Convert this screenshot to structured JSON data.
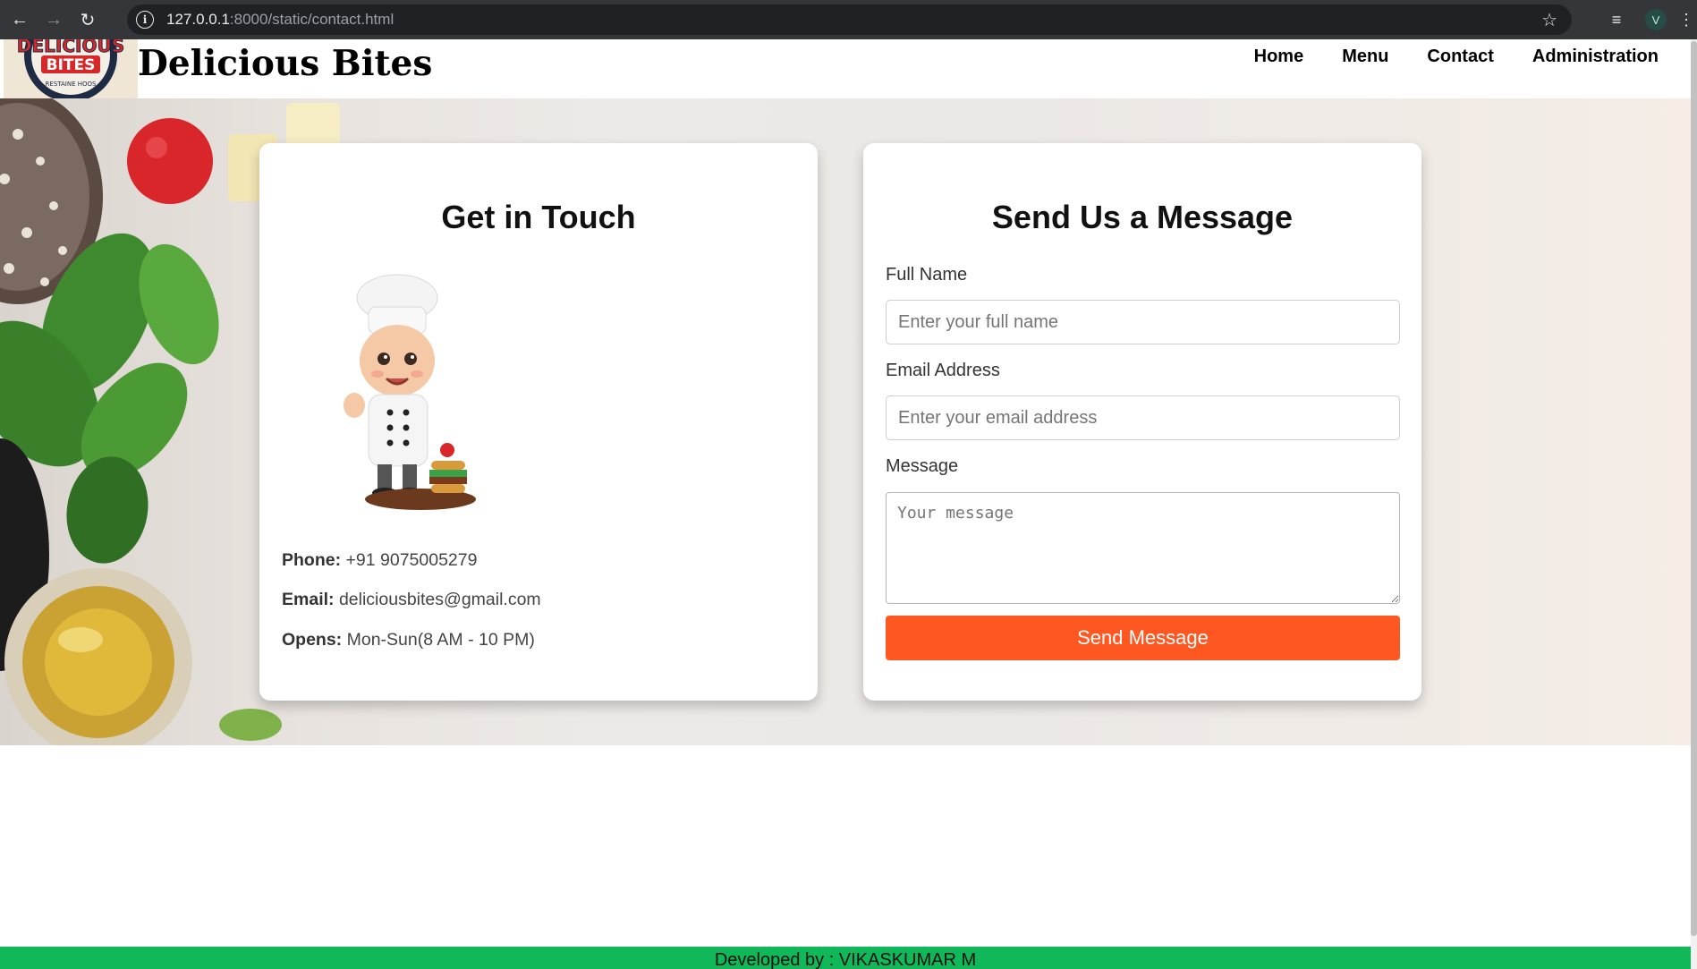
{
  "browser": {
    "url_host": "127.0.0.1",
    "url_rest": ":8000/static/contact.html",
    "profile_initial": "V"
  },
  "header": {
    "logo_text_top": "DELICIOUS",
    "logo_text_mid": "BITES",
    "logo_text_bottom": "RESTAINE HOOS",
    "brand": "Delicious Bites",
    "nav": [
      "Home",
      "Menu",
      "Contact",
      "Administration"
    ]
  },
  "contact_card": {
    "title": "Get in Touch",
    "phone_label": "Phone:",
    "phone": "+91 9075005279",
    "email_label": "Email:",
    "email": "deliciousbites@gmail.com",
    "opens_label": "Opens:",
    "opens": "Mon-Sun(8 AM - 10 PM)"
  },
  "form": {
    "title": "Send Us a Message",
    "name_label": "Full Name",
    "name_placeholder": "Enter your full name",
    "email_label": "Email Address",
    "email_placeholder": "Enter your email address",
    "message_label": "Message",
    "message_placeholder": "Your message",
    "submit": "Send Message"
  },
  "footer": {
    "text": "Developed by : VIKASKUMAR M"
  },
  "colors": {
    "accent": "#ff5722",
    "footer": "#11b85a"
  }
}
